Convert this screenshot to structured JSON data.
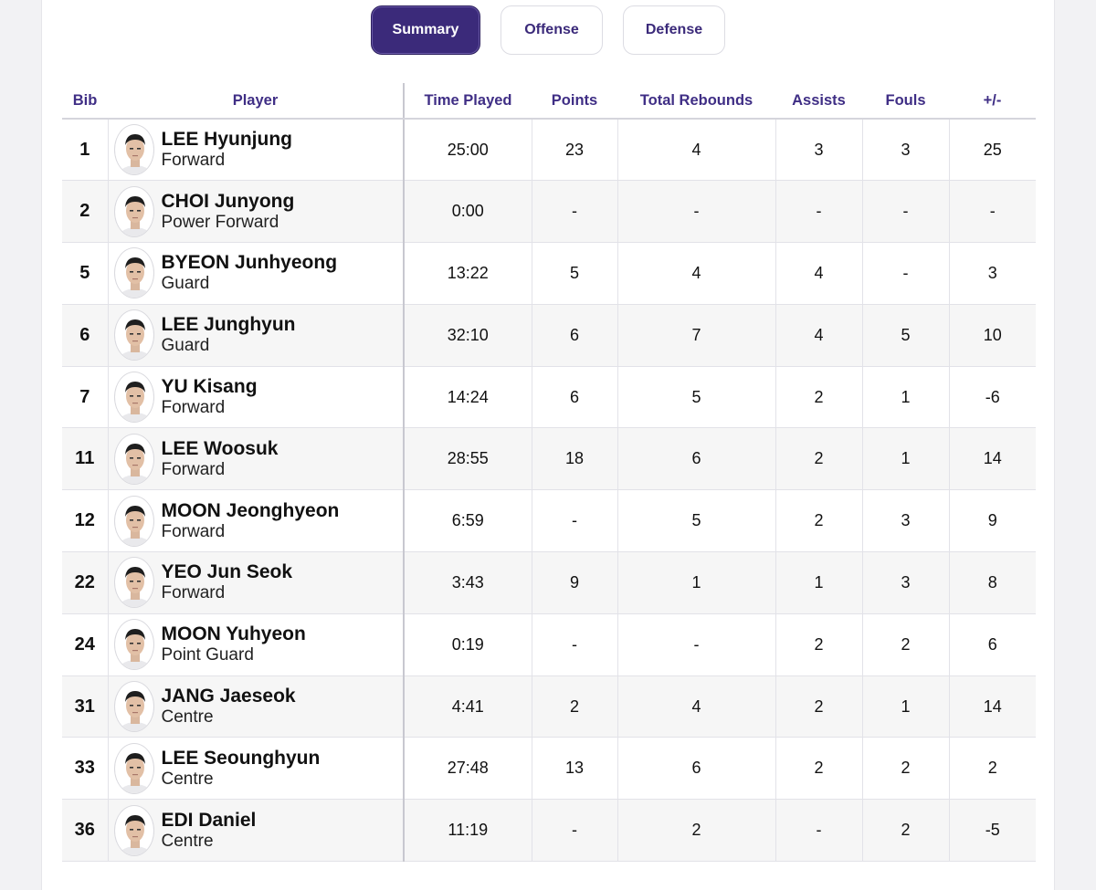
{
  "tabs": [
    {
      "label": "Summary",
      "active": true
    },
    {
      "label": "Offense",
      "active": false
    },
    {
      "label": "Defense",
      "active": false
    }
  ],
  "columns": {
    "bib": "Bib",
    "player": "Player",
    "time_played": "Time Played",
    "points": "Points",
    "total_rebounds": "Total Rebounds",
    "assists": "Assists",
    "fouls": "Fouls",
    "plus_minus": "+/-"
  },
  "rows": [
    {
      "bib": "1",
      "name": "LEE Hyunjung",
      "position": "Forward",
      "time": "25:00",
      "points": "23",
      "rebounds": "4",
      "assists": "3",
      "fouls": "3",
      "pm": "25"
    },
    {
      "bib": "2",
      "name": "CHOI Junyong",
      "position": "Power Forward",
      "time": "0:00",
      "points": "-",
      "rebounds": "-",
      "assists": "-",
      "fouls": "-",
      "pm": "-"
    },
    {
      "bib": "5",
      "name": "BYEON Junhyeong",
      "position": "Guard",
      "time": "13:22",
      "points": "5",
      "rebounds": "4",
      "assists": "4",
      "fouls": "-",
      "pm": "3"
    },
    {
      "bib": "6",
      "name": "LEE Junghyun",
      "position": "Guard",
      "time": "32:10",
      "points": "6",
      "rebounds": "7",
      "assists": "4",
      "fouls": "5",
      "pm": "10"
    },
    {
      "bib": "7",
      "name": "YU Kisang",
      "position": "Forward",
      "time": "14:24",
      "points": "6",
      "rebounds": "5",
      "assists": "2",
      "fouls": "1",
      "pm": "-6"
    },
    {
      "bib": "11",
      "name": "LEE Woosuk",
      "position": "Forward",
      "time": "28:55",
      "points": "18",
      "rebounds": "6",
      "assists": "2",
      "fouls": "1",
      "pm": "14"
    },
    {
      "bib": "12",
      "name": "MOON Jeonghyeon",
      "position": "Forward",
      "time": "6:59",
      "points": "-",
      "rebounds": "5",
      "assists": "2",
      "fouls": "3",
      "pm": "9"
    },
    {
      "bib": "22",
      "name": "YEO Jun Seok",
      "position": "Forward",
      "time": "3:43",
      "points": "9",
      "rebounds": "1",
      "assists": "1",
      "fouls": "3",
      "pm": "8"
    },
    {
      "bib": "24",
      "name": "MOON Yuhyeon",
      "position": "Point Guard",
      "time": "0:19",
      "points": "-",
      "rebounds": "-",
      "assists": "2",
      "fouls": "2",
      "pm": "6"
    },
    {
      "bib": "31",
      "name": "JANG Jaeseok",
      "position": "Centre",
      "time": "4:41",
      "points": "2",
      "rebounds": "4",
      "assists": "2",
      "fouls": "1",
      "pm": "14"
    },
    {
      "bib": "33",
      "name": "LEE Seounghyun",
      "position": "Centre",
      "time": "27:48",
      "points": "13",
      "rebounds": "6",
      "assists": "2",
      "fouls": "2",
      "pm": "2"
    },
    {
      "bib": "36",
      "name": "EDI Daniel",
      "position": "Centre",
      "time": "11:19",
      "points": "-",
      "rebounds": "2",
      "assists": "-",
      "fouls": "2",
      "pm": "-5"
    }
  ],
  "icons": {
    "avatar": "player-headshot-icon"
  },
  "colors": {
    "accent": "#3b2a7a",
    "header_text": "#3f2e85",
    "row_alt": "#f6f6f6"
  }
}
